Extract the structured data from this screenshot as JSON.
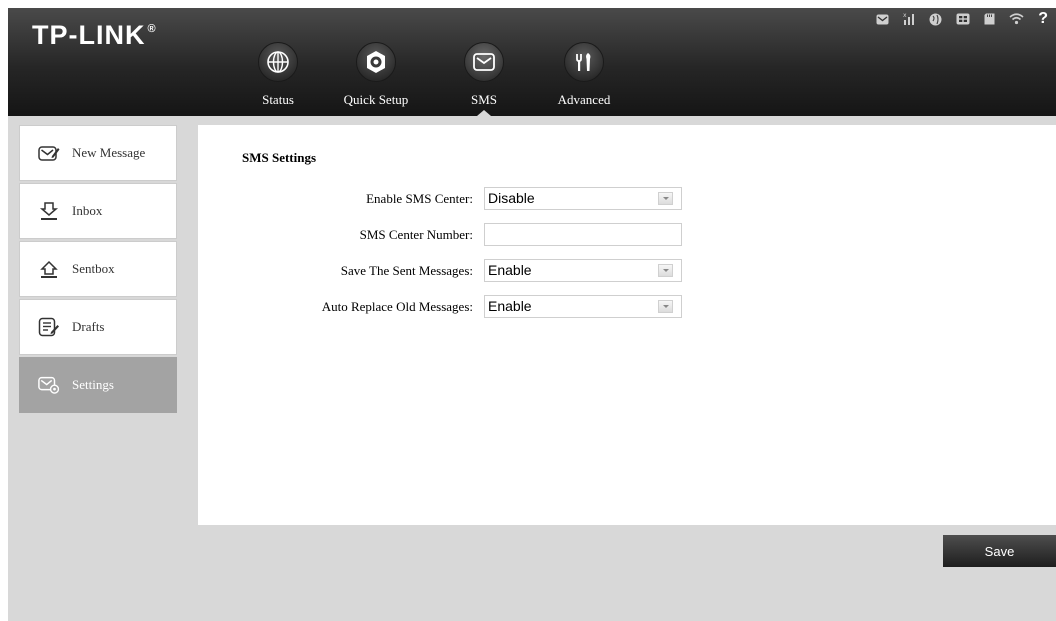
{
  "brand": {
    "logo": "TP-LINK",
    "logo_mark": "®"
  },
  "nav": [
    {
      "label": "Status",
      "icon": "globe-icon"
    },
    {
      "label": "Quick Setup",
      "icon": "gear-icon"
    },
    {
      "label": "SMS",
      "icon": "envelope-icon",
      "active": true
    },
    {
      "label": "Advanced",
      "icon": "tools-icon"
    }
  ],
  "status_bar": [
    "sms-status-icon",
    "signal-icon",
    "internet-icon",
    "network-mode-icon",
    "sd-card-icon",
    "wifi-icon",
    "help-icon"
  ],
  "status_bar_help": "?",
  "sidebar": {
    "items": [
      {
        "label": "New Message",
        "icon": "new-message-icon"
      },
      {
        "label": "Inbox",
        "icon": "inbox-icon"
      },
      {
        "label": "Sentbox",
        "icon": "sentbox-icon"
      },
      {
        "label": "Drafts",
        "icon": "drafts-icon"
      },
      {
        "label": "Settings",
        "icon": "settings-icon",
        "active": true
      }
    ]
  },
  "settings": {
    "title": "SMS Settings",
    "fields": {
      "enable_sms_center": {
        "label": "Enable SMS Center:",
        "value": "Disable"
      },
      "sms_center_number": {
        "label": "SMS Center Number:",
        "value": ""
      },
      "save_sent": {
        "label": "Save The Sent Messages:",
        "value": "Enable"
      },
      "auto_replace": {
        "label": "Auto Replace Old Messages:",
        "value": "Enable"
      }
    }
  },
  "actions": {
    "save_label": "Save"
  },
  "colors": {
    "header_dark": "#1a1a1a",
    "page_bg": "#d8d8d8",
    "sidebar_active": "#a3a3a3"
  }
}
